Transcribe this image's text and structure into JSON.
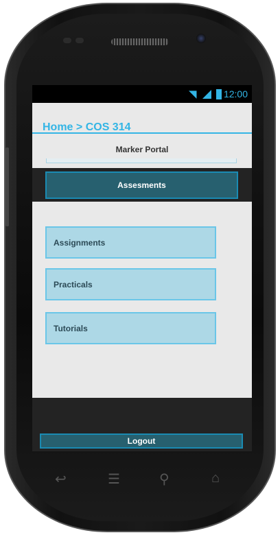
{
  "status_bar": {
    "time": "12:00",
    "icons": [
      "wifi-icon",
      "signal-icon",
      "battery-icon"
    ]
  },
  "breadcrumb": "Home > COS 314",
  "portal_title": "Marker Portal",
  "nav_button": "Assesments",
  "items": [
    {
      "label": "Assignments"
    },
    {
      "label": "Practicals"
    },
    {
      "label": "Tutorials"
    }
  ],
  "logout_label": "Logout",
  "colors": {
    "accent": "#33b5e5",
    "button": "#27606f",
    "item_bg": "#add8e6",
    "dark": "#232323"
  },
  "device_keys": [
    "back-icon",
    "menu-icon",
    "search-icon",
    "home-icon"
  ]
}
